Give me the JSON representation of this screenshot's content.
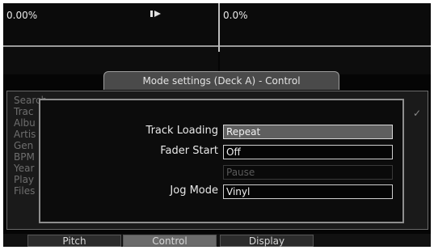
{
  "decks": {
    "left_value": "0.00%",
    "right_value": "0.0%"
  },
  "dialog": {
    "title": "Mode settings (Deck A) - Control",
    "settings": [
      {
        "label": "Track Loading",
        "value": "Repeat"
      },
      {
        "label": "Fader Start",
        "value": "Off"
      },
      {
        "label": "",
        "value": "Pause"
      },
      {
        "label": "Jog Mode",
        "value": "Vinyl"
      }
    ]
  },
  "browser": {
    "items": [
      "Search",
      "Trac",
      "Albu",
      "Artis",
      "Gen",
      "BPM",
      "Year",
      "Play",
      "Files"
    ]
  },
  "tabs": [
    "Pitch",
    "Control",
    "Display"
  ],
  "colors": {
    "background": "#050505",
    "panel_border": "#8e8e8e",
    "active_tab": "#6b6b6b",
    "selected_field": "#5f5f5f"
  },
  "icons": {
    "deck_play": "play-icon"
  }
}
